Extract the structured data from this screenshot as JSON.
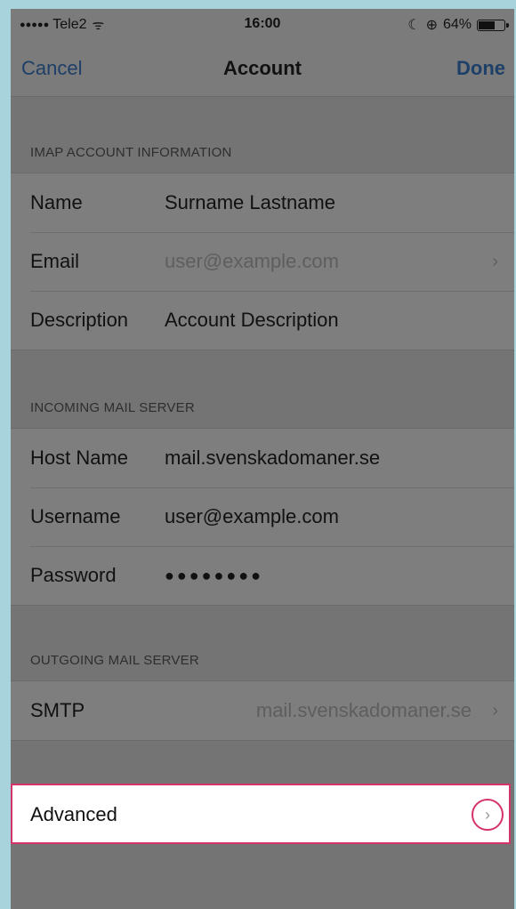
{
  "status_bar": {
    "signal": "●●●●●",
    "carrier": "Tele2",
    "wifi": "ᯤ",
    "time": "16:00",
    "moon": "☾",
    "rotation_lock": "⊕",
    "battery_percent": "64%",
    "battery_level": 0.64
  },
  "nav": {
    "cancel": "Cancel",
    "title": "Account",
    "done": "Done"
  },
  "imap": {
    "header": "IMAP ACCOUNT INFORMATION",
    "name_label": "Name",
    "name_value": "Surname Lastname",
    "email_label": "Email",
    "email_value": "user@example.com",
    "description_label": "Description",
    "description_value": "Account Description"
  },
  "incoming": {
    "header": "INCOMING MAIL SERVER",
    "host_label": "Host Name",
    "host_value": "mail.svenskadomaner.se",
    "username_label": "Username",
    "username_value": "user@example.com",
    "password_label": "Password",
    "password_value": "●●●●●●●●"
  },
  "outgoing": {
    "header": "OUTGOING MAIL SERVER",
    "smtp_label": "SMTP",
    "smtp_value": "mail.svenskadomaner.se"
  },
  "advanced": {
    "label": "Advanced"
  },
  "icons": {
    "chevron": "›"
  },
  "colors": {
    "accent_blue": "#1e3f67",
    "highlight": "#d6336c"
  }
}
